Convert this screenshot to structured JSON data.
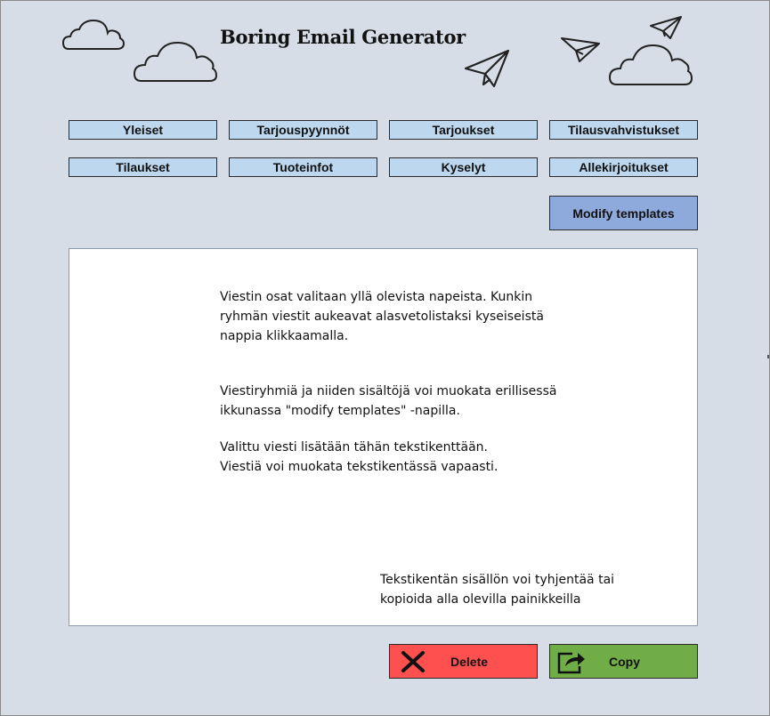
{
  "app": {
    "title": "Boring Email Generator"
  },
  "categories": [
    {
      "label": "Yleiset"
    },
    {
      "label": "Tarjouspyynnöt"
    },
    {
      "label": "Tarjoukset"
    },
    {
      "label": "Tilausvahvistukset"
    },
    {
      "label": "Tilaukset"
    },
    {
      "label": "Tuoteinfot"
    },
    {
      "label": "Kyselyt"
    },
    {
      "label": "Allekirjoitukset"
    }
  ],
  "modify": {
    "label": "Modify templates"
  },
  "textbox": {
    "para1": "Viestin osat valitaan yllä olevista napeista. Kunkin\nryhmän viestit aukeavat alasvetolistaksi kyseiseistä\nnappia klikkaamalla.",
    "para2": "Viestiryhmiä ja niiden sisältöjä voi muokata erillisessä\nikkunassa \"modify templates\" -napilla.",
    "para3": "Valittu viesti lisätään tähän tekstikenttään.\nViestiä voi muokata tekstikentässä vapaasti.",
    "para4": "Tekstikentän sisällön voi tyhjentää tai\nkopioida alla olevilla painikkeilla"
  },
  "actions": {
    "delete_label": "Delete",
    "copy_label": "Copy"
  },
  "colors": {
    "background": "#d6dde6",
    "category_button": "#bdd7ee",
    "modify_button": "#8ea9db",
    "delete_button": "#ff5050",
    "copy_button": "#70ad47"
  },
  "icons": {
    "delete": "close-x-icon",
    "copy": "share-arrow-icon",
    "decor": [
      "cloud-icon",
      "paper-plane-icon"
    ]
  }
}
